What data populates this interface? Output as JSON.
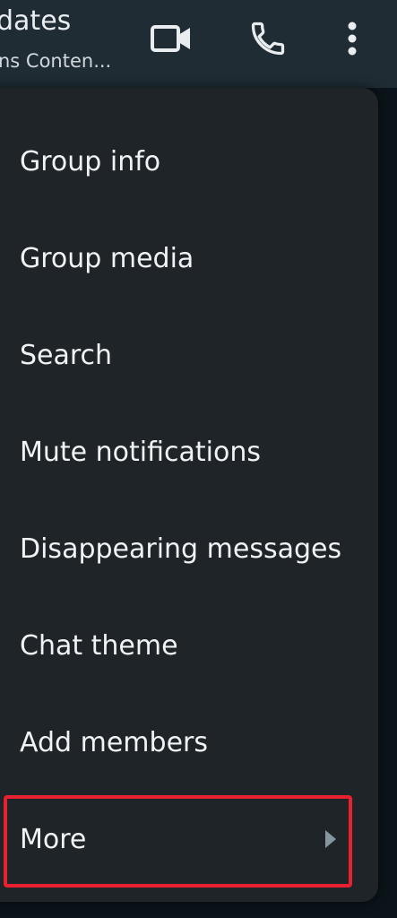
{
  "header": {
    "title": "dates",
    "subtitle": "ns Conten..."
  },
  "header_icons": [
    "video-call-icon",
    "voice-call-icon",
    "more-options-icon"
  ],
  "menu": {
    "items": [
      {
        "label": "Group info"
      },
      {
        "label": "Group media"
      },
      {
        "label": "Search"
      },
      {
        "label": "Mute notifications"
      },
      {
        "label": "Disappearing messages"
      },
      {
        "label": "Chat theme"
      },
      {
        "label": "Add members"
      },
      {
        "label": "More",
        "has_submenu": true,
        "highlighted": true
      }
    ]
  },
  "colors": {
    "appbar": "#1f2c34",
    "menu_background": "#1f2428",
    "text": "#f0f2f5",
    "highlight": "#e8202f"
  }
}
